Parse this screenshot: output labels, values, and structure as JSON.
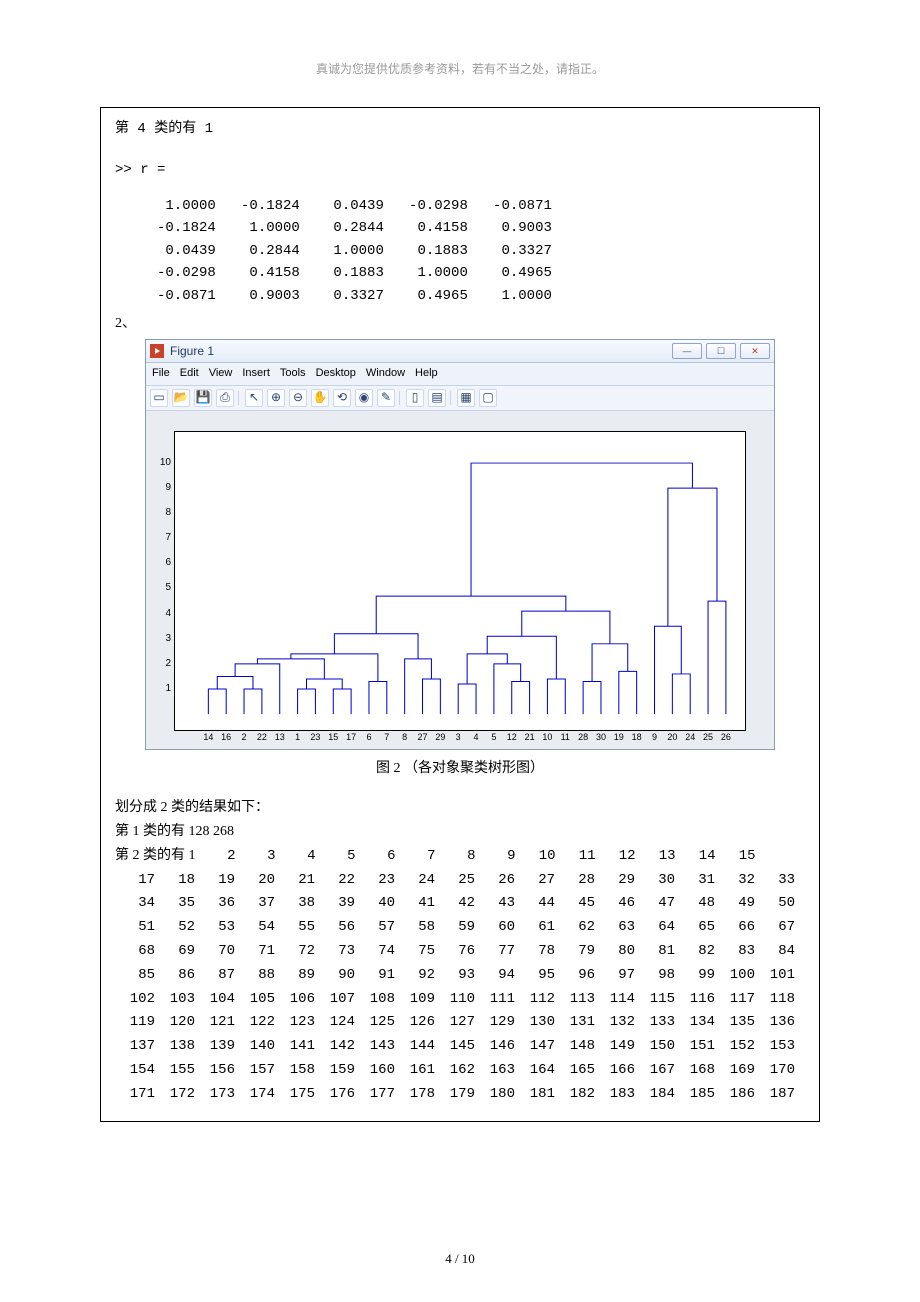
{
  "header_note": "真诚为您提供优质参考资料，若有不当之处，请指正。",
  "class4_line": "第 4 类的有 1",
  "r_prompt": ">> r =",
  "r_matrix": [
    [
      "1.0000",
      "-0.1824",
      "0.0439",
      "-0.0298",
      "-0.0871"
    ],
    [
      "-0.1824",
      "1.0000",
      "0.2844",
      "0.4158",
      "0.9003"
    ],
    [
      "0.0439",
      "0.2844",
      "1.0000",
      "0.1883",
      "0.3327"
    ],
    [
      "-0.0298",
      "0.4158",
      "0.1883",
      "1.0000",
      "0.4965"
    ],
    [
      "-0.0871",
      "0.9003",
      "0.3327",
      "0.4965",
      "1.0000"
    ]
  ],
  "section2_label": "2、",
  "figure_window": {
    "title": "Figure 1",
    "menu": [
      "File",
      "Edit",
      "View",
      "Insert",
      "Tools",
      "Desktop",
      "Window",
      "Help"
    ],
    "tool_icons": [
      "new-file-icon",
      "open-icon",
      "save-icon",
      "print-icon",
      "sep",
      "pointer-icon",
      "zoom-in-icon",
      "zoom-out-icon",
      "pan-icon",
      "rotate-icon",
      "datatip-icon",
      "brush-icon",
      "sep",
      "colorbar-icon",
      "legend-icon",
      "sep",
      "layout-icon",
      "axes-icon"
    ],
    "win_buttons": {
      "min": "—",
      "max": "☐",
      "close": "✕"
    }
  },
  "chart_data": {
    "type": "dendrogram",
    "title": "",
    "xlabel": "",
    "ylabel": "",
    "y_ticks": [
      1,
      2,
      3,
      4,
      5,
      6,
      7,
      8,
      9,
      10
    ],
    "x_leaf_labels": [
      14,
      16,
      2,
      22,
      13,
      1,
      23,
      15,
      17,
      6,
      7,
      8,
      27,
      29,
      3,
      4,
      5,
      12,
      21,
      10,
      11,
      28,
      30,
      19,
      18,
      9,
      20,
      24,
      25,
      26
    ],
    "ylim": [
      0,
      11
    ],
    "merges_approx": [
      {
        "left_leaves": [
          14,
          16
        ],
        "height": 1
      },
      {
        "left_leaves": [
          2,
          22
        ],
        "height": 1
      },
      {
        "left_leaves": [
          14,
          16,
          2,
          22
        ],
        "height": 1.5
      },
      {
        "left_leaves": [
          14,
          16,
          2,
          22,
          13
        ],
        "height": 2
      },
      {
        "left_leaves": [
          1,
          23
        ],
        "height": 1
      },
      {
        "left_leaves": [
          15,
          17
        ],
        "height": 1
      },
      {
        "left_leaves": [
          1,
          23,
          15,
          17
        ],
        "height": 1.4
      },
      {
        "left_leaves": [
          14,
          16,
          2,
          22,
          13,
          1,
          23,
          15,
          17
        ],
        "height": 2.2
      },
      {
        "left_leaves": [
          6,
          7
        ],
        "height": 1.3
      },
      {
        "left_leaves": [
          14,
          16,
          2,
          22,
          13,
          1,
          23,
          15,
          17,
          6,
          7
        ],
        "height": 2.4
      },
      {
        "left_leaves": [
          27,
          29
        ],
        "height": 1.4
      },
      {
        "left_leaves": [
          8,
          27,
          29
        ],
        "height": 2.2
      },
      {
        "left_leaves": [
          14,
          16,
          2,
          22,
          13,
          1,
          23,
          15,
          17,
          6,
          7,
          8,
          27,
          29
        ],
        "height": 3.2
      },
      {
        "left_leaves": [
          3,
          4
        ],
        "height": 1.2
      },
      {
        "left_leaves": [
          12,
          21
        ],
        "height": 1.3
      },
      {
        "left_leaves": [
          5,
          12,
          21
        ],
        "height": 2
      },
      {
        "left_leaves": [
          3,
          4,
          5,
          12,
          21
        ],
        "height": 2.4
      },
      {
        "left_leaves": [
          10,
          11
        ],
        "height": 1.4
      },
      {
        "left_leaves": [
          3,
          4,
          5,
          12,
          21,
          10,
          11
        ],
        "height": 3.1
      },
      {
        "left_leaves": [
          28,
          30
        ],
        "height": 1.3
      },
      {
        "left_leaves": [
          19,
          18
        ],
        "height": 1.7
      },
      {
        "left_leaves": [
          28,
          30,
          19,
          18
        ],
        "height": 2.8
      },
      {
        "left_leaves": [
          3,
          4,
          5,
          12,
          21,
          10,
          11,
          28,
          30,
          19,
          18
        ],
        "height": 4.1
      },
      {
        "left_leaves": [
          14,
          16,
          2,
          22,
          13,
          1,
          23,
          15,
          17,
          6,
          7,
          8,
          27,
          29,
          3,
          4,
          5,
          12,
          21,
          10,
          11,
          28,
          30,
          19,
          18
        ],
        "height": 4.7
      },
      {
        "left_leaves": [
          20,
          24
        ],
        "height": 1.6
      },
      {
        "left_leaves": [
          9,
          20,
          24
        ],
        "height": 3.5
      },
      {
        "left_leaves": [
          25,
          26
        ],
        "height": 4.5
      },
      {
        "left_leaves": [
          9,
          20,
          24,
          25,
          26
        ],
        "height": 9
      },
      {
        "left_leaves": "all",
        "height": 10
      }
    ]
  },
  "caption": "图 2 （各对象聚类树形图）",
  "split_intro": "划分成 2 类的结果如下：",
  "class1_line": "第 1 类的有 128   268",
  "class2_prefix": "第 2 类的有 1",
  "class2_rows": [
    [
      2,
      3,
      4,
      5,
      6,
      7,
      8,
      9,
      10,
      11,
      12,
      13,
      14,
      15
    ],
    [
      17,
      18,
      19,
      20,
      21,
      22,
      23,
      24,
      25,
      26,
      27,
      28,
      29,
      30,
      31,
      32,
      33
    ],
    [
      34,
      35,
      36,
      37,
      38,
      39,
      40,
      41,
      42,
      43,
      44,
      45,
      46,
      47,
      48,
      49,
      50
    ],
    [
      51,
      52,
      53,
      54,
      55,
      56,
      57,
      58,
      59,
      60,
      61,
      62,
      63,
      64,
      65,
      66,
      67
    ],
    [
      68,
      69,
      70,
      71,
      72,
      73,
      74,
      75,
      76,
      77,
      78,
      79,
      80,
      81,
      82,
      83,
      84
    ],
    [
      85,
      86,
      87,
      88,
      89,
      90,
      91,
      92,
      93,
      94,
      95,
      96,
      97,
      98,
      99,
      100,
      101
    ],
    [
      102,
      103,
      104,
      105,
      106,
      107,
      108,
      109,
      110,
      111,
      112,
      113,
      114,
      115,
      116,
      117,
      118
    ],
    [
      119,
      120,
      121,
      122,
      123,
      124,
      125,
      126,
      127,
      129,
      130,
      131,
      132,
      133,
      134,
      135,
      136
    ],
    [
      137,
      138,
      139,
      140,
      141,
      142,
      143,
      144,
      145,
      146,
      147,
      148,
      149,
      150,
      151,
      152,
      153
    ],
    [
      154,
      155,
      156,
      157,
      158,
      159,
      160,
      161,
      162,
      163,
      164,
      165,
      166,
      167,
      168,
      169,
      170
    ],
    [
      171,
      172,
      173,
      174,
      175,
      176,
      177,
      178,
      179,
      180,
      181,
      182,
      183,
      184,
      185,
      186,
      187
    ]
  ],
  "footer": "4 / 10"
}
